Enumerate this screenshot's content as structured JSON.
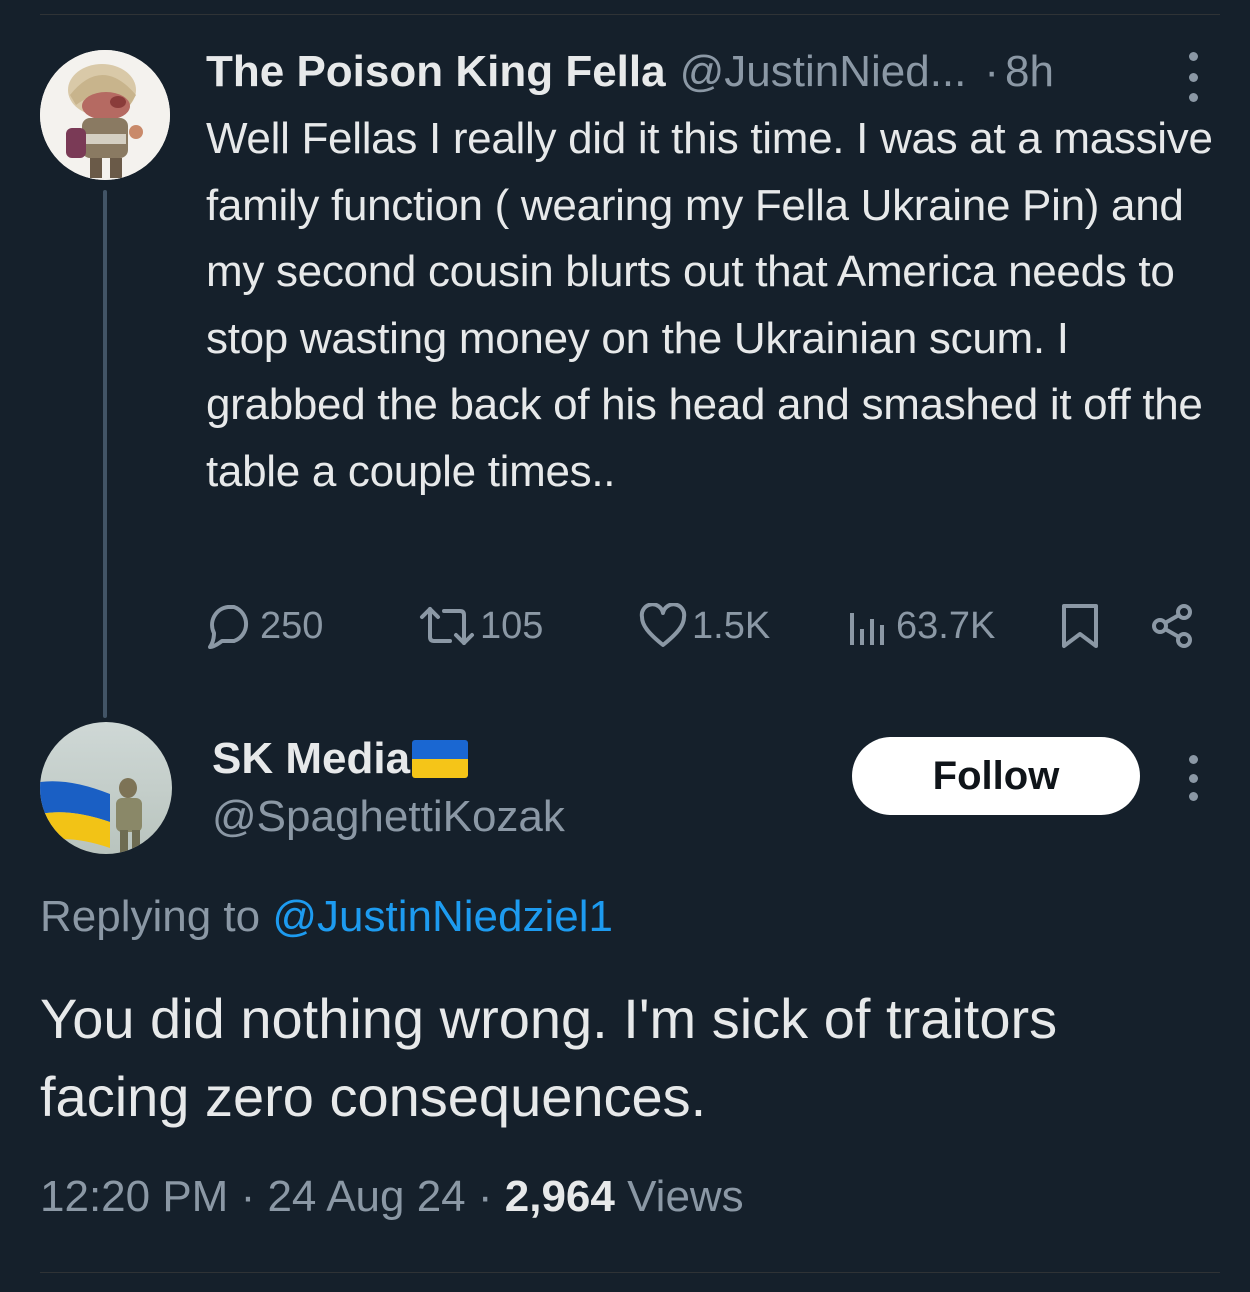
{
  "parent_tweet": {
    "display_name": "The Poison King Fella",
    "handle": "@JustinNied...",
    "separator": "·",
    "time": "8h",
    "text": "Well Fellas I really did it this time. I was at a massive family function ( wearing my Fella Ukraine Pin) and my second cousin blurts out that America needs to stop wasting money on the Ukrainian scum. I grabbed the back of his head and smashed it off the table a couple times..",
    "actions": {
      "replies": "250",
      "reposts": "105",
      "likes": "1.5K",
      "views": "63.7K"
    }
  },
  "reply_tweet": {
    "display_name": "SK Media",
    "handle": "@SpaghettiKozak",
    "follow_label": "Follow",
    "replying_prefix": "Replying to ",
    "replying_mention": "@JustinNiedziel1",
    "text": "You did nothing wrong. I'm sick of traitors facing zero consequences.",
    "time": "12:20 PM",
    "date": "24 Aug 24",
    "views_count": "2,964",
    "views_label": "Views",
    "meta_separator": " · "
  },
  "colors": {
    "background": "#15202b",
    "text_primary": "#e7e9ea",
    "text_secondary": "#8b98a5",
    "accent": "#1d9bf0",
    "flag_blue": "#1a67d2",
    "flag_yellow": "#f5c518"
  },
  "icons": {
    "reply": "speech-bubble-icon",
    "repost": "repost-arrows-icon",
    "like": "heart-icon",
    "views": "bar-chart-icon",
    "bookmark": "bookmark-icon",
    "share": "share-icon",
    "more": "vertical-ellipsis-icon"
  }
}
